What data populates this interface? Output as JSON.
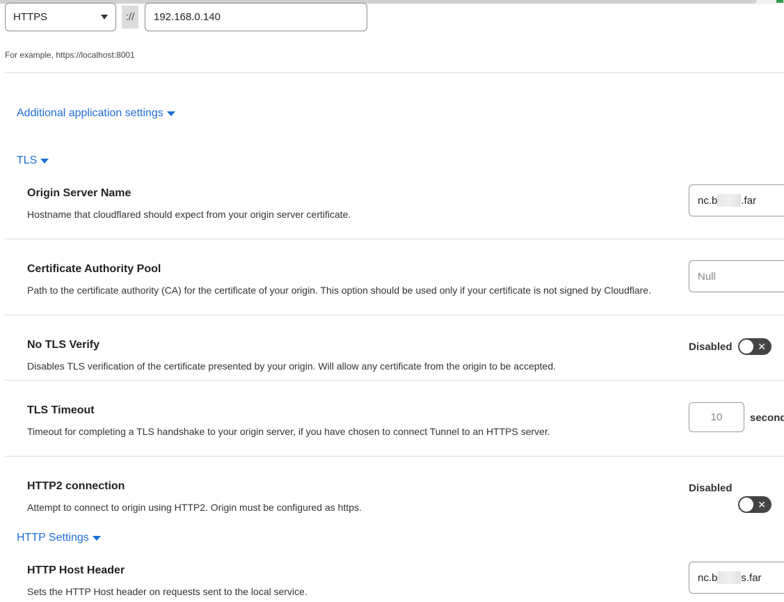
{
  "origin": {
    "protocol": "HTTPS",
    "separator": "://",
    "url": "192.168.0.140",
    "hint": "For example, https://localhost:8001"
  },
  "additional_settings": {
    "label": "Additional application settings"
  },
  "tls": {
    "label": "TLS",
    "origin_server_name": {
      "title": "Origin Server Name",
      "description": "Hostname that cloudflared should expect from your origin server certificate.",
      "value_prefix": "nc.b",
      "value_suffix": ".far"
    },
    "ca_pool": {
      "title": "Certificate Authority Pool",
      "description": "Path to the certificate authority (CA) for the certificate of your origin. This option should be used only if your certificate is not signed by Cloudflare.",
      "placeholder": "Null"
    },
    "no_tls_verify": {
      "title": "No TLS Verify",
      "description": "Disables TLS verification of the certificate presented by your origin. Will allow any certificate from the origin to be accepted.",
      "state": "Disabled",
      "toggle_glyph": "✕"
    },
    "tls_timeout": {
      "title": "TLS Timeout",
      "description": "Timeout for completing a TLS handshake to your origin server, if you have chosen to connect Tunnel to an HTTPS server.",
      "placeholder": "10",
      "unit": "second"
    },
    "http2": {
      "title": "HTTP2 connection",
      "description": "Attempt to connect to origin using HTTP2. Origin must be configured as https.",
      "state": "Disabled",
      "toggle_glyph": "✕"
    }
  },
  "http_settings": {
    "label": "HTTP Settings",
    "host_header": {
      "title": "HTTP Host Header",
      "description": "Sets the HTTP Host header on requests sent to the local service.",
      "value_prefix": "nc.b",
      "value_suffix": "s.far"
    }
  },
  "colors": {
    "link": "#1d6fd8",
    "toggle_off": "#444444"
  }
}
